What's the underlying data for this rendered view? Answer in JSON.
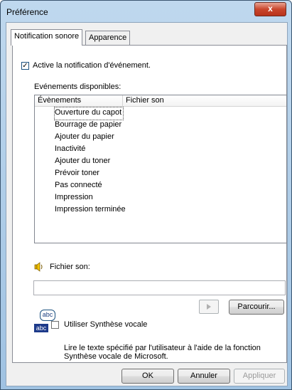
{
  "window": {
    "title": "Préférence",
    "close_glyph": "x"
  },
  "tabs": [
    {
      "label": "Notification sonore",
      "active": true
    },
    {
      "label": "Apparence",
      "active": false
    }
  ],
  "notification": {
    "enable_label": "Active la notification d'événement.",
    "enable_checked": true,
    "enable_mark": "✓"
  },
  "events": {
    "section_label": "Evénements disponibles:",
    "columns": [
      "Évènements",
      "Fichier son"
    ],
    "rows": [
      "Ouverture du capot",
      "Bourrage de papier",
      "Ajouter du papier",
      "Inactivité",
      "Ajouter du toner",
      "Prévoir toner",
      "Pas connecté",
      "Impression",
      "Impression terminée"
    ],
    "selected_index": 0
  },
  "sound": {
    "label": "Fichier son:",
    "value": "",
    "browse_label": "Parcourir...",
    "speaker_icon": "speaker-icon",
    "play_icon": "play-icon"
  },
  "tts": {
    "icon_top": "abc",
    "icon_bottom": "abc",
    "checkbox_label": "Utiliser Synthèse vocale",
    "checked": false,
    "description_line1": "Lire le texte spécifié par l'utilisateur à l'aide de la fonction",
    "description_line2": "Synthèse vocale de Microsoft."
  },
  "buttons": {
    "ok": "OK",
    "cancel": "Annuler",
    "apply": "Appliquer"
  }
}
